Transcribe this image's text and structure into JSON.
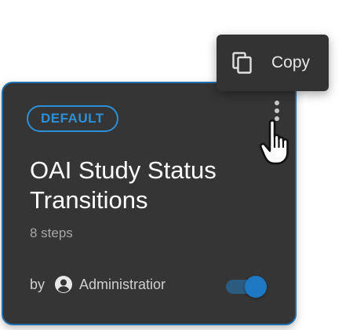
{
  "card": {
    "badge": "DEFAULT",
    "title": "OAI Study Status Transitions",
    "steps": "8 steps",
    "by_label": "by",
    "author": "Administratior",
    "toggle_on": true,
    "more_icon": "kebab-vertical-icon",
    "author_icon": "account-circle-icon"
  },
  "menu": {
    "items": [
      {
        "label": "Copy",
        "icon": "copy-icon"
      }
    ]
  },
  "cursor": {
    "icon": "hand-pointer-icon"
  },
  "colors": {
    "card_bg": "#353535",
    "card_border": "#1f6fae",
    "accent": "#2d8fd6",
    "menu_bg": "#333333"
  }
}
